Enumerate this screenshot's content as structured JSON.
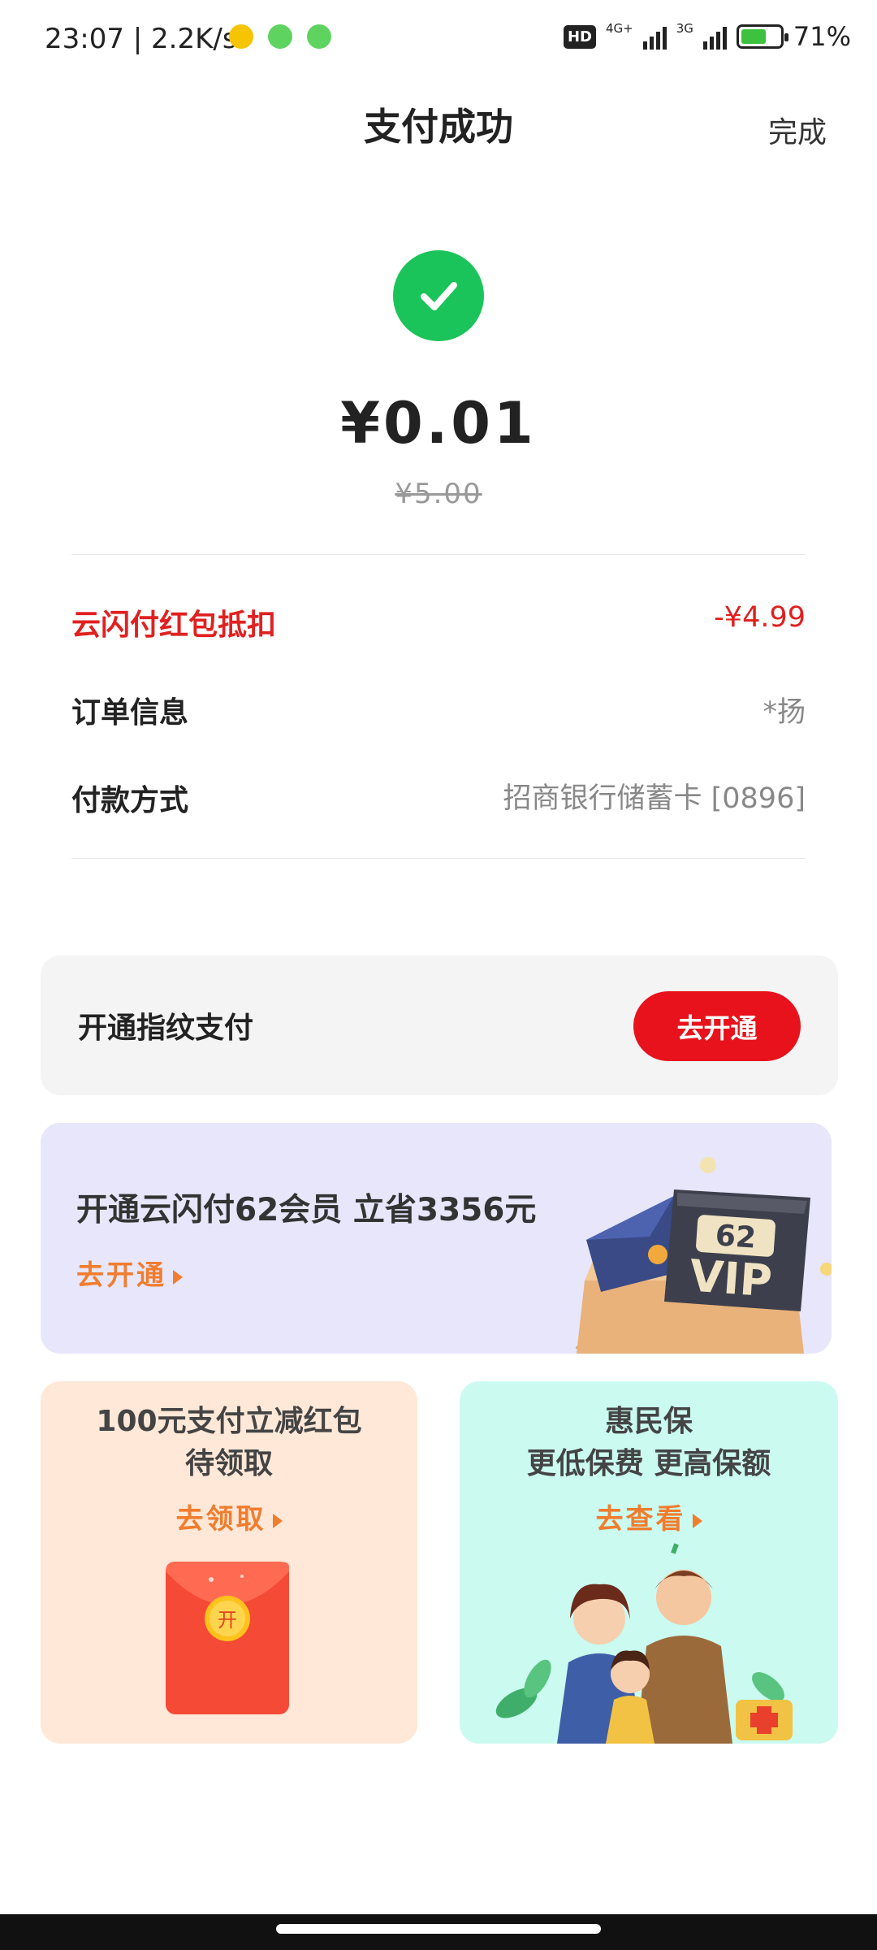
{
  "status_bar": {
    "time_speed": "23:07 | 2.2K/s",
    "network_4g": "4G+",
    "network_3g": "3G",
    "hd": "HD",
    "battery": "71%"
  },
  "header": {
    "title": "支付成功",
    "done_label": "完成"
  },
  "payment": {
    "amount": "¥0.01",
    "original_amount": "¥5.00"
  },
  "details": [
    {
      "label": "云闪付红包抵扣",
      "value": "-¥4.99"
    },
    {
      "label": "订单信息",
      "value": "*扬"
    },
    {
      "label": "付款方式",
      "value": "招商银行储蓄卡 [0896]"
    }
  ],
  "fingerprint": {
    "text": "开通指纹支付",
    "button_label": "去开通"
  },
  "vip_banner": {
    "title": "开通云闪付62会员 立省3356元",
    "link": "去开通",
    "badge_number": "62",
    "badge_text": "VIP"
  },
  "card_redpacket": {
    "title_line1": "100元支付立减红包",
    "title_line2": "待领取",
    "link": "去领取",
    "packet_label": "开"
  },
  "card_insurance": {
    "title_line1": "惠民保",
    "title_line2": "更低保费 更高保额",
    "link": "去查看"
  },
  "colors": {
    "accent_red": "#e8121c",
    "success_green": "#1bc45a",
    "link_orange": "#f07d2e"
  }
}
